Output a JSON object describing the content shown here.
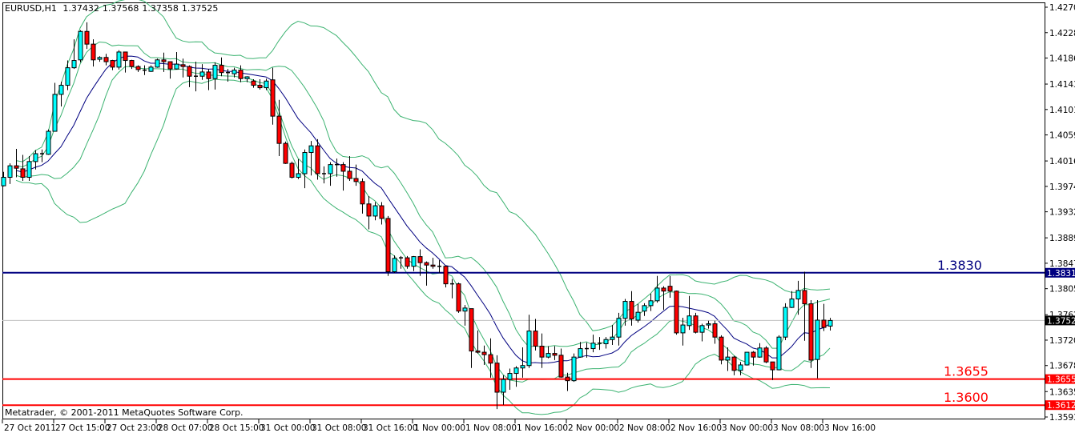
{
  "header": {
    "symbol": "EURUSD,H1",
    "open": "1.37432",
    "high": "1.37568",
    "low": "1.37358",
    "close": "1.37525"
  },
  "copyright": "Metatrader, © 2001-2011 MetaQuotes Software Corp.",
  "chart_data": {
    "type": "candlestick",
    "symbol": "EURUSD",
    "timeframe": "H1",
    "ylim": [
      1.3593,
      1.427
    ],
    "price_ticks": [
      "1.42700",
      "1.42280",
      "1.41860",
      "1.41430",
      "1.41010",
      "1.40590",
      "1.40160",
      "1.39740",
      "1.39320",
      "1.38890",
      "1.38470",
      "1.38050",
      "1.37620",
      "1.37200",
      "1.36780",
      "1.36350",
      "1.35930"
    ],
    "time_labels": [
      "27 Oct 2011",
      "27 Oct 15:00",
      "27 Oct 23:00",
      "28 Oct 07:00",
      "28 Oct 15:00",
      "31 Oct 00:00",
      "31 Oct 08:00",
      "31 Oct 16:00",
      "1 Nov 00:00",
      "1 Nov 08:00",
      "1 Nov 16:00",
      "2 Nov 00:00",
      "2 Nov 08:00",
      "2 Nov 16:00",
      "3 Nov 00:00",
      "3 Nov 08:00",
      "3 Nov 16:00"
    ],
    "bars_per_time_label": 8,
    "colors": {
      "bull": "#00ffff",
      "bear": "#ff0000",
      "outline": "#000000",
      "ma": "#000080",
      "bands": "#3cb371"
    },
    "indicators": [
      {
        "type": "SMA",
        "period": 10,
        "color": "#000080"
      },
      {
        "type": "Bollinger",
        "period": 20,
        "deviation": 2,
        "color": "#3cb371"
      },
      {
        "type": "Bollinger",
        "period": 10,
        "deviation": 1,
        "color": "#3cb371"
      }
    ],
    "hlines": [
      {
        "price": 1.38313,
        "label": "1.3830",
        "axis_label": "1.38313",
        "color": "#000080"
      },
      {
        "price": 1.36557,
        "label": "1.3655",
        "axis_label": "1.36557",
        "color": "#ff0000"
      },
      {
        "price": 1.36126,
        "label": "1.3600",
        "axis_label": "1.36126",
        "color": "#ff0000"
      }
    ],
    "current_price": {
      "price": 1.37525,
      "axis_label": "1.37525",
      "color": "#000000"
    },
    "candles": [
      [
        1.3975,
        1.3998,
        1.3974,
        1.3989
      ],
      [
        1.3989,
        1.4012,
        1.3978,
        1.4008
      ],
      [
        1.4008,
        1.4036,
        1.3989,
        1.4004
      ],
      [
        1.4003,
        1.4026,
        1.3983,
        1.3989
      ],
      [
        1.3989,
        1.4024,
        1.3983,
        1.4015
      ],
      [
        1.4015,
        1.4034,
        1.4002,
        1.4028
      ],
      [
        1.4028,
        1.4035,
        1.4014,
        1.4028
      ],
      [
        1.4027,
        1.4068,
        1.4026,
        1.4065
      ],
      [
        1.4065,
        1.4145,
        1.4065,
        1.4126
      ],
      [
        1.4126,
        1.4147,
        1.4106,
        1.4141
      ],
      [
        1.4141,
        1.4182,
        1.4133,
        1.417
      ],
      [
        1.417,
        1.4217,
        1.4168,
        1.4182
      ],
      [
        1.4183,
        1.4232,
        1.4179,
        1.423
      ],
      [
        1.423,
        1.4245,
        1.4201,
        1.4209
      ],
      [
        1.4209,
        1.4217,
        1.4172,
        1.4183
      ],
      [
        1.4184,
        1.4189,
        1.418,
        1.4187
      ],
      [
        1.4187,
        1.4193,
        1.4174,
        1.418
      ],
      [
        1.4182,
        1.4183,
        1.4166,
        1.4171
      ],
      [
        1.4171,
        1.4199,
        1.4167,
        1.4196
      ],
      [
        1.4196,
        1.4196,
        1.4162,
        1.4182
      ],
      [
        1.4182,
        1.4183,
        1.4168,
        1.4172
      ],
      [
        1.4172,
        1.4174,
        1.4163,
        1.4167
      ],
      [
        1.4166,
        1.4174,
        1.4158,
        1.4166
      ],
      [
        1.4164,
        1.4174,
        1.4163,
        1.4171
      ],
      [
        1.4171,
        1.4185,
        1.417,
        1.4183
      ],
      [
        1.4183,
        1.4195,
        1.4163,
        1.418
      ],
      [
        1.418,
        1.418,
        1.4152,
        1.4168
      ],
      [
        1.4168,
        1.4196,
        1.4167,
        1.4176
      ],
      [
        1.4175,
        1.4185,
        1.4154,
        1.4172
      ],
      [
        1.4172,
        1.4174,
        1.4138,
        1.4156
      ],
      [
        1.4156,
        1.418,
        1.4131,
        1.4156
      ],
      [
        1.4156,
        1.4176,
        1.415,
        1.4163
      ],
      [
        1.4163,
        1.4168,
        1.4133,
        1.4152
      ],
      [
        1.4152,
        1.4179,
        1.4134,
        1.4174
      ],
      [
        1.4174,
        1.4187,
        1.4156,
        1.4162
      ],
      [
        1.4162,
        1.4168,
        1.4147,
        1.4162
      ],
      [
        1.416,
        1.417,
        1.4154,
        1.4166
      ],
      [
        1.4166,
        1.4174,
        1.4146,
        1.4152
      ],
      [
        1.4152,
        1.4156,
        1.4146,
        1.4155
      ],
      [
        1.4148,
        1.4151,
        1.4137,
        1.4141
      ],
      [
        1.4141,
        1.4151,
        1.4134,
        1.4137
      ],
      [
        1.4137,
        1.4152,
        1.4133,
        1.4148
      ],
      [
        1.415,
        1.417,
        1.4076,
        1.409
      ],
      [
        1.409,
        1.4117,
        1.4024,
        1.4045
      ],
      [
        1.4045,
        1.4048,
        1.4011,
        1.4012
      ],
      [
        1.4012,
        1.4015,
        1.3987,
        1.3989
      ],
      [
        1.3989,
        1.4019,
        1.3986,
        1.3995
      ],
      [
        1.3995,
        1.4035,
        1.3971,
        1.403
      ],
      [
        1.403,
        1.4049,
        1.3992,
        1.4041
      ],
      [
        1.4041,
        1.4052,
        1.3985,
        1.3995
      ],
      [
        1.3995,
        1.4007,
        1.3979,
        1.3995
      ],
      [
        1.3995,
        1.4014,
        1.3975,
        1.401
      ],
      [
        1.401,
        1.402,
        1.399,
        1.401
      ],
      [
        1.401,
        1.4014,
        1.3967,
        1.3999
      ],
      [
        1.3999,
        1.4024,
        1.3983,
        1.3987
      ],
      [
        1.3987,
        1.401,
        1.3975,
        1.3982
      ],
      [
        1.3982,
        1.3987,
        1.3929,
        1.3945
      ],
      [
        1.3945,
        1.3958,
        1.3903,
        1.3925
      ],
      [
        1.3925,
        1.3948,
        1.3918,
        1.3942
      ],
      [
        1.3942,
        1.3948,
        1.3911,
        1.3921
      ],
      [
        1.3921,
        1.3925,
        1.3826,
        1.3833
      ],
      [
        1.3833,
        1.386,
        1.3831,
        1.3855
      ],
      [
        1.3855,
        1.3859,
        1.3838,
        1.3856
      ],
      [
        1.3856,
        1.3859,
        1.3838,
        1.3842
      ],
      [
        1.3842,
        1.3859,
        1.3834,
        1.3858
      ],
      [
        1.3858,
        1.387,
        1.3826,
        1.3848
      ],
      [
        1.3848,
        1.385,
        1.381,
        1.3844
      ],
      [
        1.3844,
        1.3856,
        1.3838,
        1.3842
      ],
      [
        1.3842,
        1.3852,
        1.3831,
        1.3842
      ],
      [
        1.3842,
        1.3843,
        1.3807,
        1.3813
      ],
      [
        1.3813,
        1.3821,
        1.3789,
        1.3813
      ],
      [
        1.3813,
        1.3815,
        1.3765,
        1.3768
      ],
      [
        1.3768,
        1.3778,
        1.3744,
        1.3773
      ],
      [
        1.3772,
        1.3772,
        1.3674,
        1.3702
      ],
      [
        1.3702,
        1.3736,
        1.3698,
        1.37
      ],
      [
        1.37,
        1.3711,
        1.3679,
        1.3696
      ],
      [
        1.3696,
        1.3723,
        1.3658,
        1.3682
      ],
      [
        1.3682,
        1.3695,
        1.3606,
        1.3634
      ],
      [
        1.3634,
        1.3662,
        1.3613,
        1.3655
      ],
      [
        1.3655,
        1.3673,
        1.3638,
        1.3665
      ],
      [
        1.3665,
        1.3677,
        1.3643,
        1.3674
      ],
      [
        1.3674,
        1.3708,
        1.3658,
        1.3678
      ],
      [
        1.3678,
        1.3762,
        1.3674,
        1.3735
      ],
      [
        1.3735,
        1.3755,
        1.3703,
        1.371
      ],
      [
        1.371,
        1.3731,
        1.3674,
        1.3692
      ],
      [
        1.3692,
        1.371,
        1.369,
        1.3698
      ],
      [
        1.3698,
        1.371,
        1.3687,
        1.3695
      ],
      [
        1.3695,
        1.3706,
        1.3658,
        1.3659
      ],
      [
        1.3659,
        1.3666,
        1.3636,
        1.3653
      ],
      [
        1.3653,
        1.3698,
        1.3651,
        1.3692
      ],
      [
        1.3692,
        1.3717,
        1.3691,
        1.3706
      ],
      [
        1.3706,
        1.3716,
        1.3691,
        1.3706
      ],
      [
        1.3706,
        1.3729,
        1.37,
        1.3715
      ],
      [
        1.3715,
        1.3725,
        1.3704,
        1.3714
      ],
      [
        1.3714,
        1.3725,
        1.3706,
        1.3721
      ],
      [
        1.3721,
        1.3745,
        1.3712,
        1.3725
      ],
      [
        1.3725,
        1.3765,
        1.3711,
        1.3756
      ],
      [
        1.3756,
        1.3788,
        1.3744,
        1.3784
      ],
      [
        1.3784,
        1.3801,
        1.3744,
        1.3755
      ],
      [
        1.3753,
        1.378,
        1.3749,
        1.3766
      ],
      [
        1.3768,
        1.3781,
        1.376,
        1.3777
      ],
      [
        1.3777,
        1.3797,
        1.3768,
        1.3785
      ],
      [
        1.3785,
        1.3826,
        1.3782,
        1.3806
      ],
      [
        1.3806,
        1.3809,
        1.377,
        1.3801
      ],
      [
        1.3809,
        1.3826,
        1.379,
        1.3801
      ],
      [
        1.3801,
        1.3802,
        1.3729,
        1.3732
      ],
      [
        1.3732,
        1.3757,
        1.3711,
        1.3745
      ],
      [
        1.3744,
        1.3793,
        1.3737,
        1.376
      ],
      [
        1.376,
        1.3765,
        1.3731,
        1.3733
      ],
      [
        1.3733,
        1.3747,
        1.3718,
        1.3744
      ],
      [
        1.3745,
        1.3752,
        1.3739,
        1.3747
      ],
      [
        1.3747,
        1.3752,
        1.3714,
        1.3725
      ],
      [
        1.3725,
        1.3728,
        1.368,
        1.3687
      ],
      [
        1.3687,
        1.3708,
        1.3669,
        1.3692
      ],
      [
        1.3692,
        1.3694,
        1.3662,
        1.367
      ],
      [
        1.367,
        1.3684,
        1.3662,
        1.3679
      ],
      [
        1.3679,
        1.37,
        1.3678,
        1.37
      ],
      [
        1.37,
        1.3702,
        1.3678,
        1.3692
      ],
      [
        1.3692,
        1.3715,
        1.3691,
        1.3707
      ],
      [
        1.3707,
        1.371,
        1.3682,
        1.3684
      ],
      [
        1.3684,
        1.3684,
        1.3654,
        1.3671
      ],
      [
        1.3671,
        1.3728,
        1.367,
        1.3725
      ],
      [
        1.3725,
        1.3781,
        1.372,
        1.3774
      ],
      [
        1.3774,
        1.3801,
        1.3773,
        1.3788
      ],
      [
        1.3788,
        1.3818,
        1.3762,
        1.3802
      ],
      [
        1.3802,
        1.3833,
        1.3719,
        1.378
      ],
      [
        1.378,
        1.3786,
        1.3674,
        1.3687
      ],
      [
        1.3688,
        1.3786,
        1.3657,
        1.3753
      ],
      [
        1.3753,
        1.378,
        1.3735,
        1.3741
      ],
      [
        1.37432,
        1.37568,
        1.37358,
        1.37525
      ]
    ]
  }
}
